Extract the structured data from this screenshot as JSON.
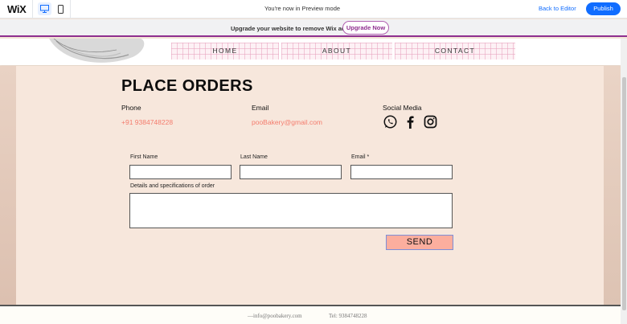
{
  "wix_bar": {
    "logo": "WiX",
    "preview_text": "You're now in Preview mode",
    "back_to_editor": "Back to Editor",
    "publish": "Publish"
  },
  "upgrade_banner": {
    "text": "Upgrade your website to remove Wix ads",
    "button": "Upgrade Now"
  },
  "nav": {
    "items": [
      {
        "label": "HOME"
      },
      {
        "label": "ABOUT"
      },
      {
        "label": "CONTACT"
      }
    ]
  },
  "main": {
    "title": "PLACE ORDERS",
    "phone_label": "Phone",
    "phone_value": "+91 9384748228",
    "email_label": "Email",
    "email_value": "pooBakery@gmail.com",
    "social_label": "Social Media",
    "social_icons": [
      "whatsapp-icon",
      "facebook-icon",
      "instagram-icon"
    ]
  },
  "form": {
    "first_name_label": "First Name",
    "last_name_label": "Last Name",
    "email_label": "Email *",
    "details_label": "Details and specifications of order",
    "first_name_value": "",
    "last_name_value": "",
    "email_value": "",
    "details_value": "",
    "send": "SEND"
  },
  "footer": {
    "email": "—info@poobakery.com",
    "phone": "Tel: 9384748228"
  },
  "colors": {
    "wix_blue": "#116dff",
    "accent_pink": "#f47c6d",
    "send_button": "#fcae9e",
    "page_bg": "#f7e7dc",
    "upgrade_purple": "#8f2f8f"
  }
}
